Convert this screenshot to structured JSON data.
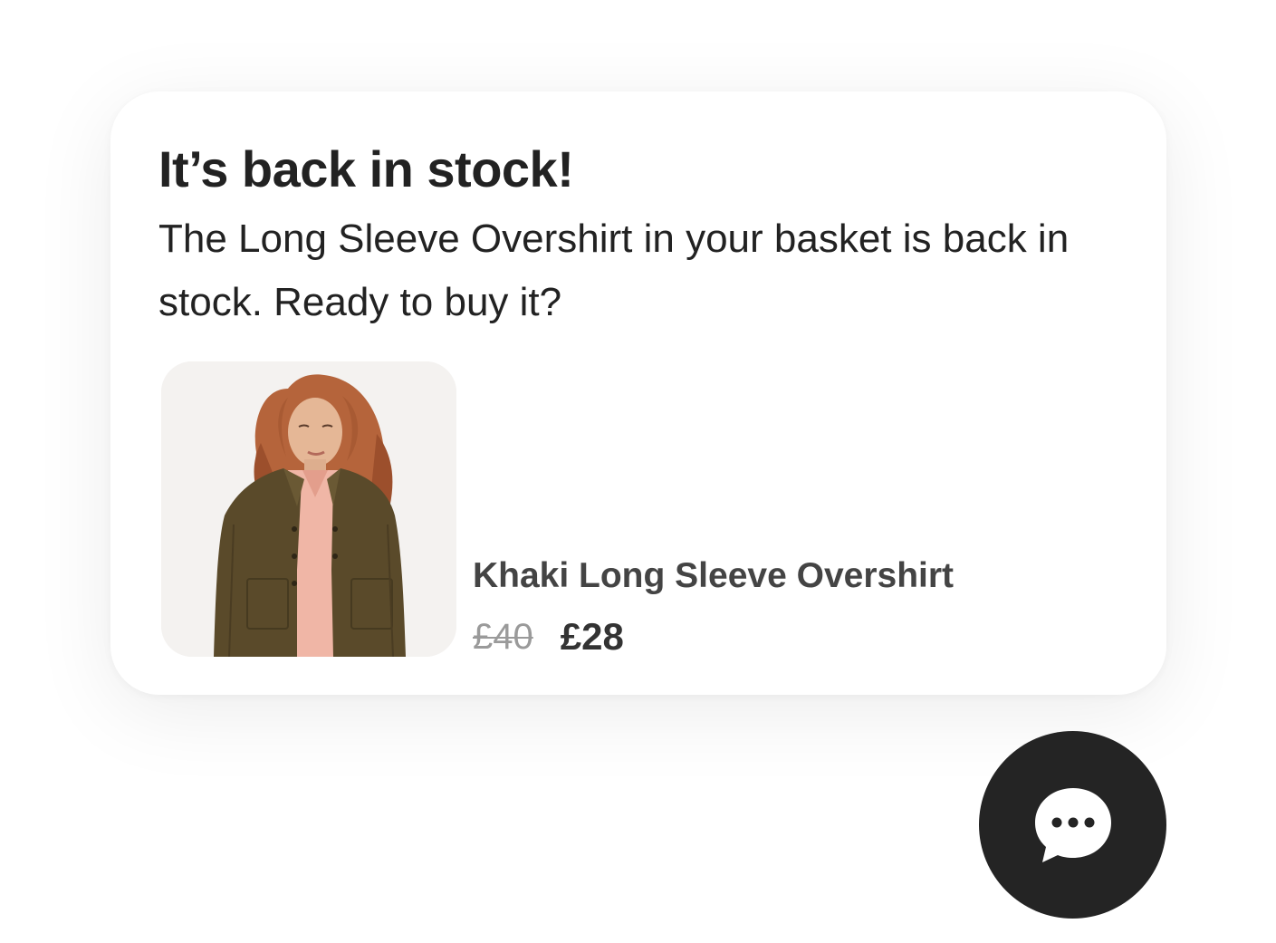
{
  "notification": {
    "title": "It’s back in stock!",
    "message": "The Long Sleeve Overshirt in your basket is back in stock. Ready to buy it?"
  },
  "product": {
    "name": "Khaki Long Sleeve Overshirt",
    "original_price": "£40",
    "sale_price": "£28",
    "image_icon": "product-photo"
  },
  "chat": {
    "icon": "chat-bubble-icon"
  },
  "colors": {
    "card_background": "#ffffff",
    "text_primary": "#222222",
    "text_secondary": "#444444",
    "price_old": "#9a9a9a",
    "chat_button": "#242424"
  }
}
